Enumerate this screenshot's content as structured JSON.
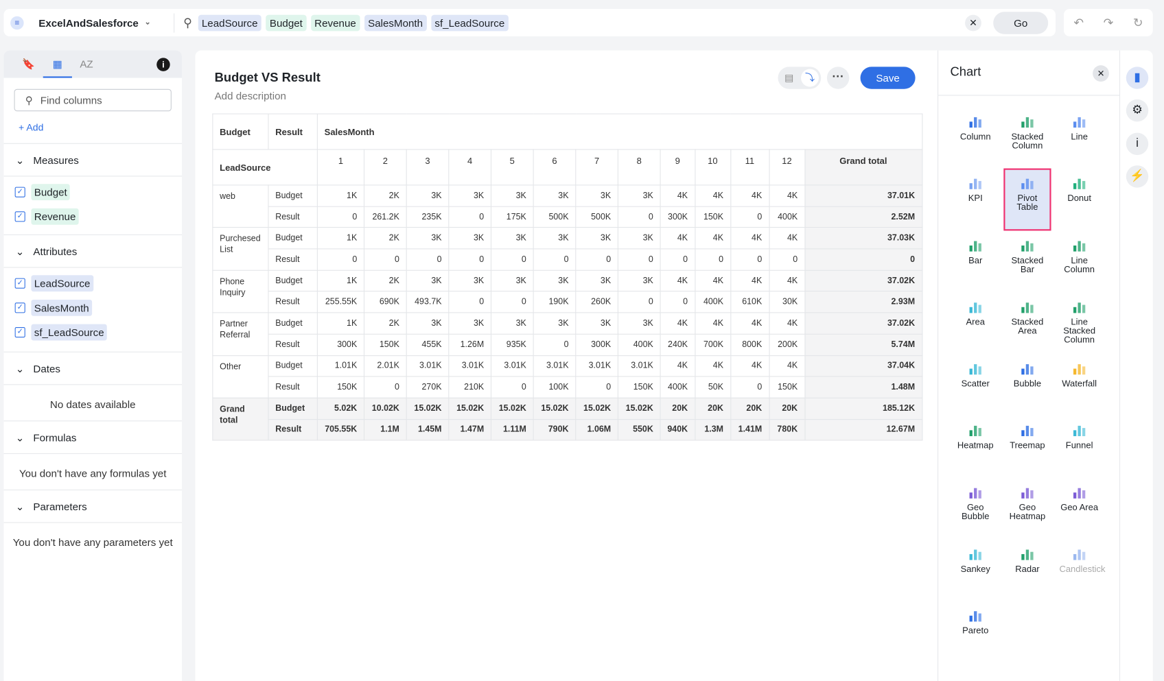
{
  "topbar": {
    "datasource": "ExcelAndSalesforce",
    "tokens": [
      {
        "label": "LeadSource",
        "kind": "attr"
      },
      {
        "label": "Budget",
        "kind": "meas"
      },
      {
        "label": "Revenue",
        "kind": "meas"
      },
      {
        "label": "SalesMonth",
        "kind": "attr"
      },
      {
        "label": "sf_LeadSource",
        "kind": "attr"
      }
    ],
    "go": "Go"
  },
  "left": {
    "find_placeholder": "Find columns",
    "add": "Add",
    "measures_title": "Measures",
    "measures": [
      "Budget",
      "Revenue"
    ],
    "attributes_title": "Attributes",
    "attributes": [
      "LeadSource",
      "SalesMonth",
      "sf_LeadSource"
    ],
    "dates_title": "Dates",
    "dates_empty": "No dates available",
    "formulas_title": "Formulas",
    "formulas_empty": "You don't have any formulas yet",
    "parameters_title": "Parameters",
    "parameters_empty": "You don't have any parameters yet"
  },
  "main": {
    "title": "Budget VS Result",
    "description": "Add description",
    "save": "Save"
  },
  "pivot": {
    "col_headers": [
      "Budget",
      "Result",
      "SalesMonth"
    ],
    "row_header": "LeadSource",
    "months": [
      "1",
      "2",
      "3",
      "4",
      "5",
      "6",
      "7",
      "8",
      "9",
      "10",
      "11",
      "12"
    ],
    "grand_total_label": "Grand total",
    "groups": [
      {
        "name": "web",
        "rows": [
          {
            "measure": "Budget",
            "values": [
              "1K",
              "2K",
              "3K",
              "3K",
              "3K",
              "3K",
              "3K",
              "3K",
              "4K",
              "4K",
              "4K",
              "4K"
            ],
            "total": "37.01K"
          },
          {
            "measure": "Result",
            "values": [
              "0",
              "261.2K",
              "235K",
              "0",
              "175K",
              "500K",
              "500K",
              "0",
              "300K",
              "150K",
              "0",
              "400K"
            ],
            "total": "2.52M"
          }
        ]
      },
      {
        "name": "Purchesed List",
        "rows": [
          {
            "measure": "Budget",
            "values": [
              "1K",
              "2K",
              "3K",
              "3K",
              "3K",
              "3K",
              "3K",
              "3K",
              "4K",
              "4K",
              "4K",
              "4K"
            ],
            "total": "37.03K"
          },
          {
            "measure": "Result",
            "values": [
              "0",
              "0",
              "0",
              "0",
              "0",
              "0",
              "0",
              "0",
              "0",
              "0",
              "0",
              "0"
            ],
            "total": "0"
          }
        ]
      },
      {
        "name": "Phone Inquiry",
        "rows": [
          {
            "measure": "Budget",
            "values": [
              "1K",
              "2K",
              "3K",
              "3K",
              "3K",
              "3K",
              "3K",
              "3K",
              "4K",
              "4K",
              "4K",
              "4K"
            ],
            "total": "37.02K"
          },
          {
            "measure": "Result",
            "values": [
              "255.55K",
              "690K",
              "493.7K",
              "0",
              "0",
              "190K",
              "260K",
              "0",
              "0",
              "400K",
              "610K",
              "30K"
            ],
            "total": "2.93M"
          }
        ]
      },
      {
        "name": "Partner Referral",
        "rows": [
          {
            "measure": "Budget",
            "values": [
              "1K",
              "2K",
              "3K",
              "3K",
              "3K",
              "3K",
              "3K",
              "3K",
              "4K",
              "4K",
              "4K",
              "4K"
            ],
            "total": "37.02K"
          },
          {
            "measure": "Result",
            "values": [
              "300K",
              "150K",
              "455K",
              "1.26M",
              "935K",
              "0",
              "300K",
              "400K",
              "240K",
              "700K",
              "800K",
              "200K"
            ],
            "total": "5.74M"
          }
        ]
      },
      {
        "name": "Other",
        "rows": [
          {
            "measure": "Budget",
            "values": [
              "1.01K",
              "2.01K",
              "3.01K",
              "3.01K",
              "3.01K",
              "3.01K",
              "3.01K",
              "3.01K",
              "4K",
              "4K",
              "4K",
              "4K"
            ],
            "total": "37.04K"
          },
          {
            "measure": "Result",
            "values": [
              "150K",
              "0",
              "270K",
              "210K",
              "0",
              "100K",
              "0",
              "150K",
              "400K",
              "50K",
              "0",
              "150K"
            ],
            "total": "1.48M"
          }
        ]
      },
      {
        "name": "Grand total",
        "grand": true,
        "rows": [
          {
            "measure": "Budget",
            "values": [
              "5.02K",
              "10.02K",
              "15.02K",
              "15.02K",
              "15.02K",
              "15.02K",
              "15.02K",
              "15.02K",
              "20K",
              "20K",
              "20K",
              "20K"
            ],
            "total": "185.12K"
          },
          {
            "measure": "Result",
            "values": [
              "705.55K",
              "1.1M",
              "1.45M",
              "1.47M",
              "1.11M",
              "790K",
              "1.06M",
              "550K",
              "940K",
              "1.3M",
              "1.41M",
              "780K"
            ],
            "total": "12.67M"
          }
        ]
      }
    ]
  },
  "chart_panel": {
    "title": "Chart",
    "selected": "Pivot Table",
    "types": [
      {
        "label": "Column",
        "color": "#2f6fe4"
      },
      {
        "label": "Stacked Column",
        "color": "#22a06b"
      },
      {
        "label": "Line",
        "color": "#5b8def"
      },
      {
        "label": "KPI",
        "color": "#7aa2f0"
      },
      {
        "label": "Pivot Table",
        "color": "#5b8def"
      },
      {
        "label": "Donut",
        "color": "#22b07d"
      },
      {
        "label": "Bar",
        "color": "#22a06b"
      },
      {
        "label": "Stacked Bar",
        "color": "#22a06b"
      },
      {
        "label": "Line Column",
        "color": "#22a06b"
      },
      {
        "label": "Area",
        "color": "#3bb9d6"
      },
      {
        "label": "Stacked Area",
        "color": "#22a06b"
      },
      {
        "label": "Line Stacked Column",
        "color": "#22a06b"
      },
      {
        "label": "Scatter",
        "color": "#3bb9d6"
      },
      {
        "label": "Bubble",
        "color": "#2f6fe4"
      },
      {
        "label": "Waterfall",
        "color": "#f5b82e"
      },
      {
        "label": "Heatmap",
        "color": "#22a06b"
      },
      {
        "label": "Treemap",
        "color": "#2f6fe4"
      },
      {
        "label": "Funnel",
        "color": "#3bb9d6"
      },
      {
        "label": "Geo Bubble",
        "color": "#7c5cd6"
      },
      {
        "label": "Geo Heatmap",
        "color": "#7c5cd6"
      },
      {
        "label": "Geo Area",
        "color": "#7c5cd6"
      },
      {
        "label": "Sankey",
        "color": "#3bb9d6"
      },
      {
        "label": "Radar",
        "color": "#22a06b"
      },
      {
        "label": "Candlestick",
        "color": "#9bb8ef",
        "disabled": true
      },
      {
        "label": "Pareto",
        "color": "#2f6fe4"
      }
    ]
  }
}
